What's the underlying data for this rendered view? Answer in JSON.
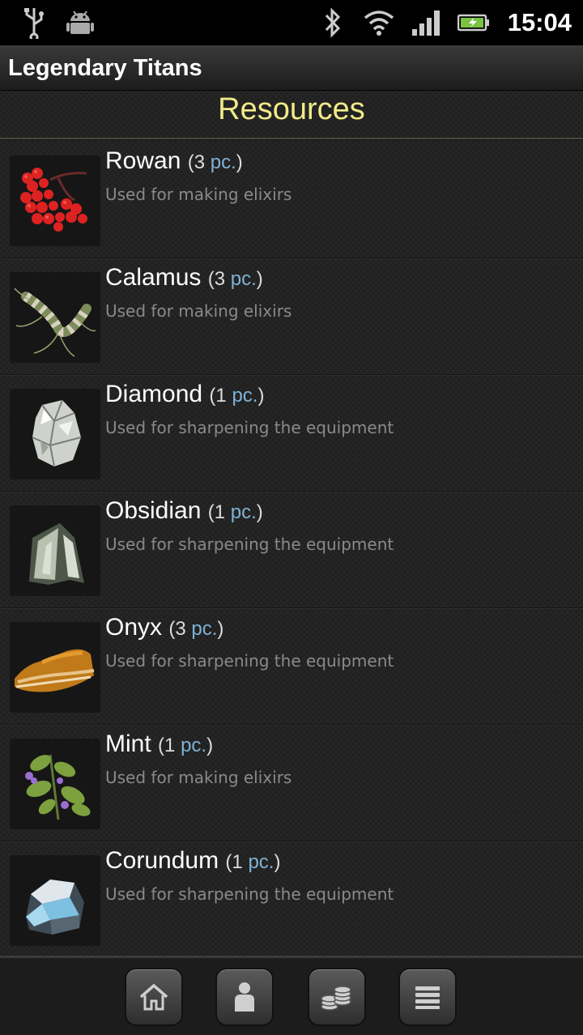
{
  "status_bar": {
    "time": "15:04",
    "icons": [
      "usb-icon",
      "android-debug-icon",
      "bluetooth-icon",
      "wifi-icon",
      "signal-icon",
      "battery-charging-icon"
    ]
  },
  "app": {
    "title": "Legendary Titans"
  },
  "section": {
    "title": "Resources"
  },
  "resources": [
    {
      "name": "Rowan",
      "qty": "3",
      "unit": "pc.",
      "description": "Used for making elixirs",
      "icon": "rowan-icon"
    },
    {
      "name": "Calamus",
      "qty": "3",
      "unit": "pc.",
      "description": "Used for making elixirs",
      "icon": "calamus-icon"
    },
    {
      "name": "Diamond",
      "qty": "1",
      "unit": "pc.",
      "description": "Used for sharpening the equipment",
      "icon": "diamond-icon"
    },
    {
      "name": "Obsidian",
      "qty": "1",
      "unit": "pc.",
      "description": "Used for sharpening the equipment",
      "icon": "obsidian-icon"
    },
    {
      "name": "Onyx",
      "qty": "3",
      "unit": "pc.",
      "description": "Used for sharpening the equipment",
      "icon": "onyx-icon"
    },
    {
      "name": "Mint",
      "qty": "1",
      "unit": "pc.",
      "description": "Used for making elixirs",
      "icon": "mint-icon"
    },
    {
      "name": "Corundum",
      "qty": "1",
      "unit": "pc.",
      "description": "Used for sharpening the equipment",
      "icon": "corundum-icon"
    }
  ],
  "bottom_nav": [
    "home-icon",
    "character-icon",
    "coins-icon",
    "menu-icon"
  ],
  "colors": {
    "header_text": "#f2ea8a",
    "unit_text": "#7fb2d4",
    "desc_text": "#8a8a8a"
  }
}
